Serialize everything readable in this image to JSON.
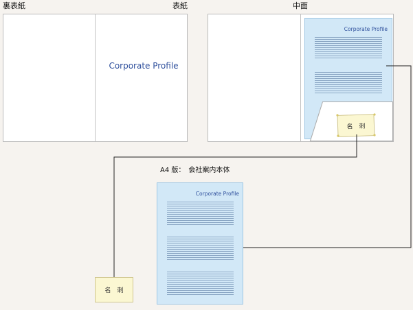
{
  "labels": {
    "back_cover": "裏表紙",
    "front_cover": "表紙",
    "inside": "中面",
    "a4_caption": "A4 版：　会社案内本体"
  },
  "cover_title": "Corporate Profile",
  "pocket_doc_title": "Corporate Profile",
  "a4_doc_title": "Corporate Profile",
  "card_in_pocket": "名　刺",
  "card_loose": "名　刺",
  "colors": {
    "background": "#f6f3ef",
    "panel": "#ffffff",
    "panel_border": "#b9b9b9",
    "doc_fill": "#d2e8f7",
    "doc_border": "#9fc6e3",
    "doc_lines": "#8aa6c4",
    "brand_text": "#2e4f9c",
    "card_fill": "#fbf7d2",
    "card_border": "#cfc58e",
    "connector": "#222222"
  }
}
